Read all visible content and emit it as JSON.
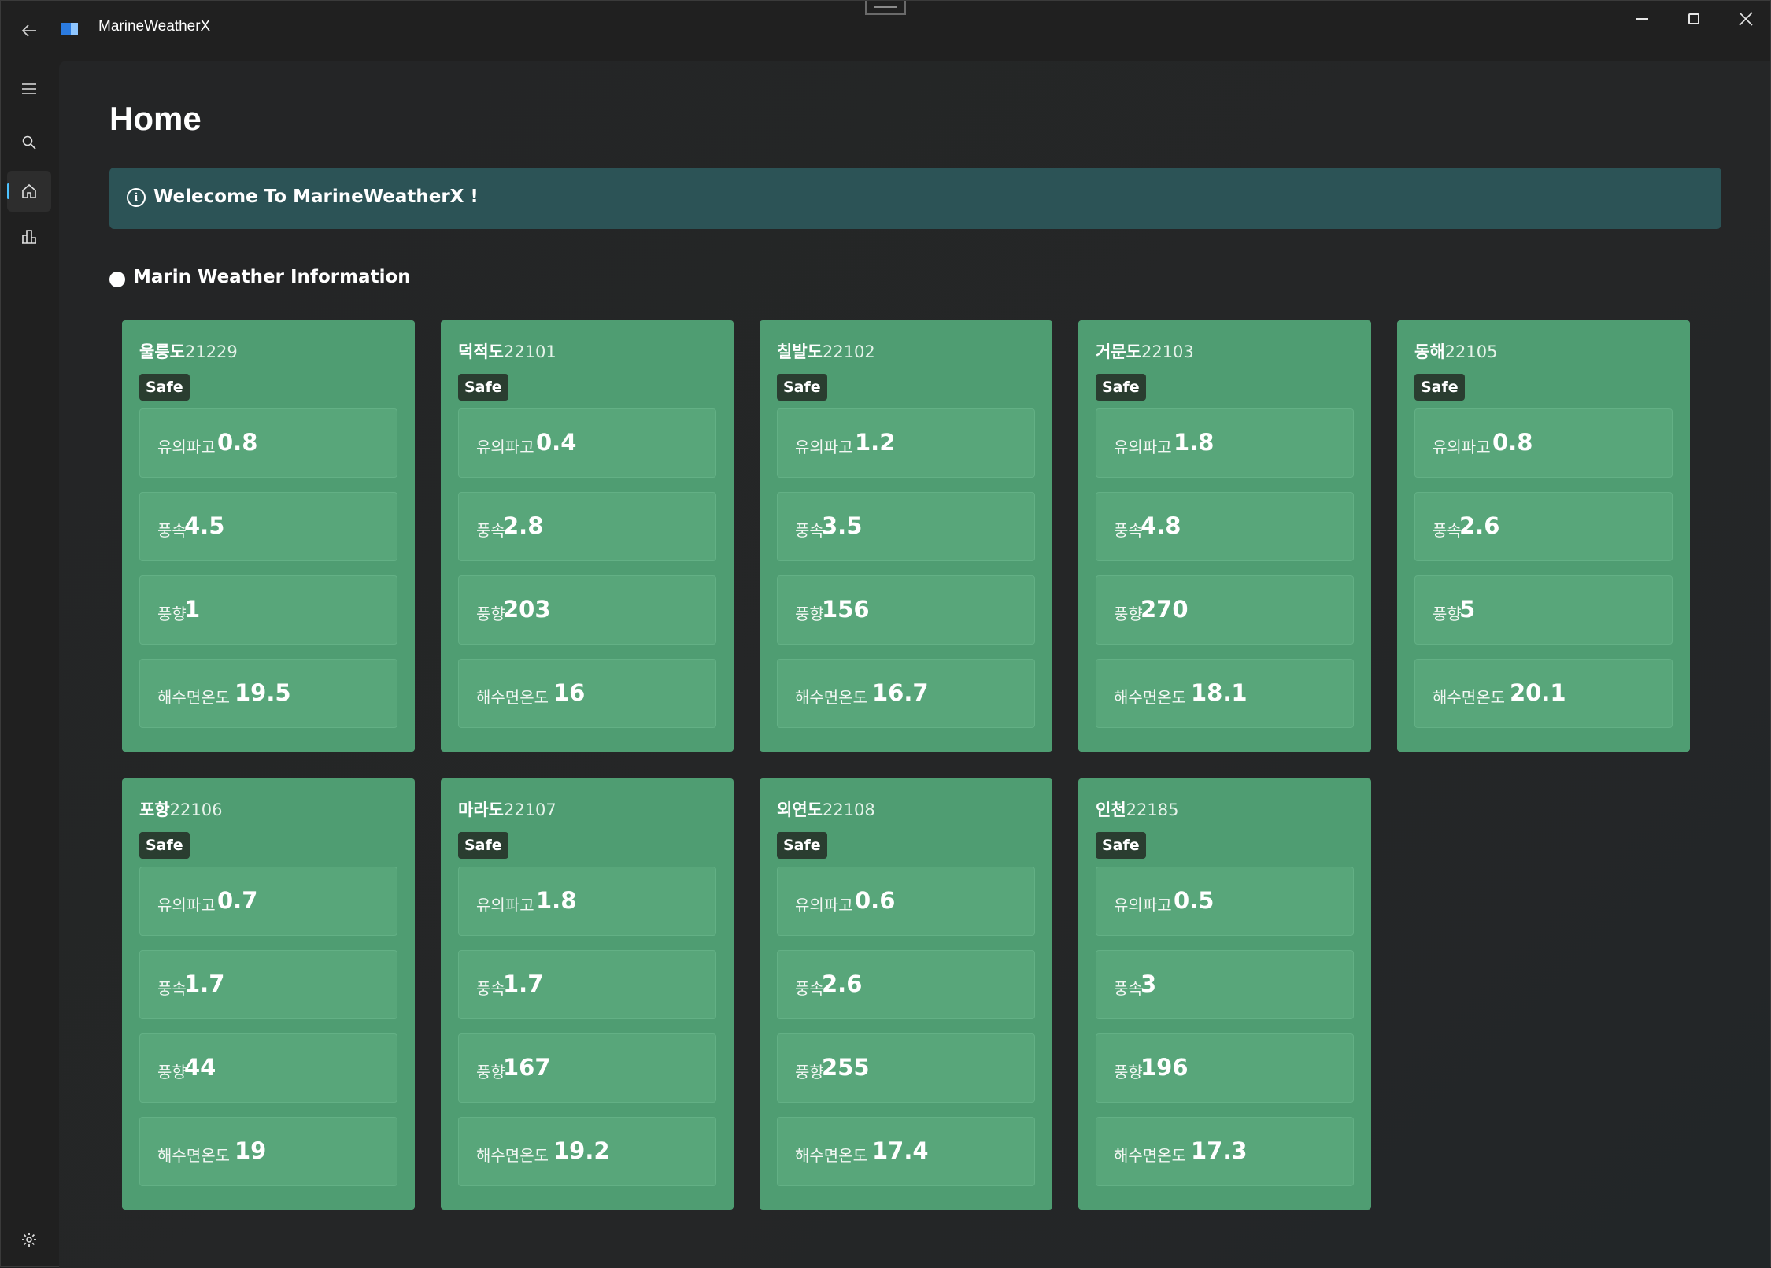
{
  "window": {
    "title": "MarineWeatherX"
  },
  "page": {
    "title": "Home",
    "welcome": "Welecome To MarineWeatherX !",
    "section_title": "Marin Weather Information"
  },
  "labels": {
    "wave": "유의파고",
    "wind_speed": "풍속",
    "wind_dir": "풍향",
    "sst": "해수면온도"
  },
  "stations": [
    {
      "name": "울릉도",
      "code": "21229",
      "status": "Safe",
      "wave": "0.8",
      "wind_speed": "4.5",
      "wind_dir": "1",
      "sst": "19.5"
    },
    {
      "name": "덕적도",
      "code": "22101",
      "status": "Safe",
      "wave": "0.4",
      "wind_speed": "2.8",
      "wind_dir": "203",
      "sst": "16"
    },
    {
      "name": "칠발도",
      "code": "22102",
      "status": "Safe",
      "wave": "1.2",
      "wind_speed": "3.5",
      "wind_dir": "156",
      "sst": "16.7"
    },
    {
      "name": "거문도",
      "code": "22103",
      "status": "Safe",
      "wave": "1.8",
      "wind_speed": "4.8",
      "wind_dir": "270",
      "sst": "18.1"
    },
    {
      "name": "동해",
      "code": "22105",
      "status": "Safe",
      "wave": "0.8",
      "wind_speed": "2.6",
      "wind_dir": "5",
      "sst": "20.1"
    },
    {
      "name": "포항",
      "code": "22106",
      "status": "Safe",
      "wave": "0.7",
      "wind_speed": "1.7",
      "wind_dir": "44",
      "sst": "19"
    },
    {
      "name": "마라도",
      "code": "22107",
      "status": "Safe",
      "wave": "1.8",
      "wind_speed": "1.7",
      "wind_dir": "167",
      "sst": "19.2"
    },
    {
      "name": "외연도",
      "code": "22108",
      "status": "Safe",
      "wave": "0.6",
      "wind_speed": "2.6",
      "wind_dir": "255",
      "sst": "17.4"
    },
    {
      "name": "인천",
      "code": "22185",
      "status": "Safe",
      "wave": "0.5",
      "wind_speed": "3",
      "wind_dir": "196",
      "sst": "17.3"
    }
  ],
  "icons": {
    "back": "back-arrow-icon",
    "menu": "hamburger-menu-icon",
    "search": "search-icon",
    "home": "home-icon",
    "chart": "bar-chart-icon",
    "settings": "gear-icon",
    "info": "info-icon"
  },
  "colors": {
    "card": "#4f9d72",
    "metric": "#58a67a",
    "badge": "#2a3d30",
    "infobar": "#2c5356",
    "accent": "#4cc2ff"
  }
}
